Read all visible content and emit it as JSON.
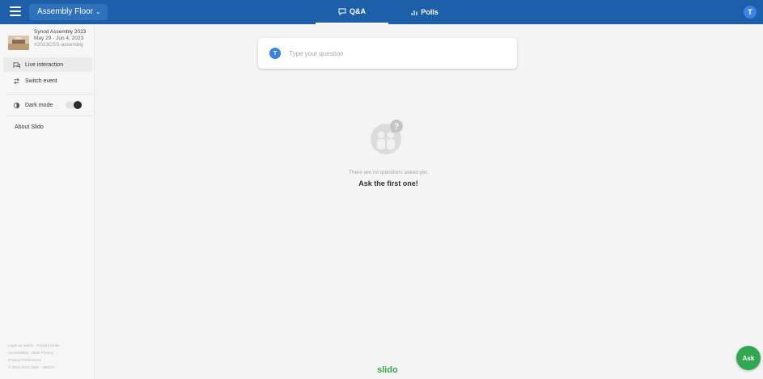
{
  "topbar": {
    "event_name": "Assembly Floor",
    "tabs": [
      {
        "label": "Q&A",
        "active": true
      },
      {
        "label": "Polls",
        "active": false
      }
    ],
    "user_initial": "T",
    "color": "#1d5fa8"
  },
  "sidebar": {
    "event": {
      "name": "Synod Assembly 2023",
      "dates": "May 29 - Jun 4, 2023",
      "hashtag": "#2023CSS-assembly"
    },
    "items": [
      {
        "label": "Live interaction",
        "icon": "chat-icon",
        "active": true
      },
      {
        "label": "Switch event",
        "icon": "switch-icon",
        "active": false
      }
    ],
    "dark_mode_label": "Dark mode",
    "about_label": "About Slido",
    "footer": {
      "line1_a": "Login as admin",
      "line1_b": "Present mode",
      "line2_a": "Accessibility",
      "line2_b": "Slido Privacy",
      "line3": "Privacy Preferences",
      "line4": "© 2012-2023 Slido · 498237"
    }
  },
  "main": {
    "question_placeholder": "Type your question",
    "user_initial": "T",
    "empty_text": "There are no questions asked yet.",
    "empty_cta": "Ask the first one!",
    "brand": "slido",
    "ask_label": "Ask",
    "accent_green": "#2fa84f"
  }
}
